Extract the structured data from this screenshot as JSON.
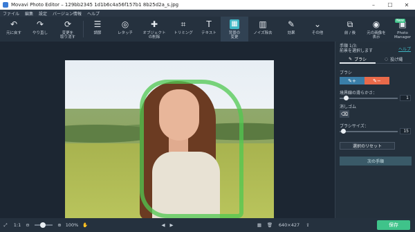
{
  "window": {
    "title": "Movavi Photo Editor – 129bb2345 1d1b6c4a56f157b1 8b25d2a_s.jpg"
  },
  "menu": [
    "ファイル",
    "編集",
    "設定",
    "バージョン情報",
    "ヘルプ"
  ],
  "toolbar": {
    "undo": "元に戻す",
    "redo": "やり直し",
    "revert": "変更を\n取り消す",
    "adjust": "調節",
    "retouch": "レタッチ",
    "remove_object": "オブジェクト\nの削除",
    "crop": "トリミング",
    "text": "テキスト",
    "background": "背景の\n変更",
    "denoise": "ノイズ除去",
    "effects": "効果",
    "more": "その他",
    "before_after": "前 / 後",
    "show_original": "元の画像を\n表示",
    "photo_manager": "Photo\nManager",
    "new_badge": "New"
  },
  "panel": {
    "step": "手順 1/3:",
    "step_desc": "前景を選択します",
    "help": "ヘルプ",
    "tab_brush": "ブラシ",
    "tab_lasso": "投げ縄",
    "brush_label": "ブラシ",
    "brush_add": "+",
    "brush_remove": "−",
    "edge_label": "境界線の滑らかさ：",
    "edge_value": "1",
    "eraser_label": "消しゴム",
    "size_label": "ブラシサイズ：",
    "size_value": "15",
    "reset_label": "選択のリセット",
    "next_label": "次の手順"
  },
  "status": {
    "scale": "1:1",
    "zoom": "100%",
    "dimensions": "640×427",
    "save": "保存"
  },
  "colors": {
    "accent": "#3fb7c4",
    "selection": "#50c850",
    "save": "#3fc38a",
    "remove_brush": "#e96a4a"
  }
}
